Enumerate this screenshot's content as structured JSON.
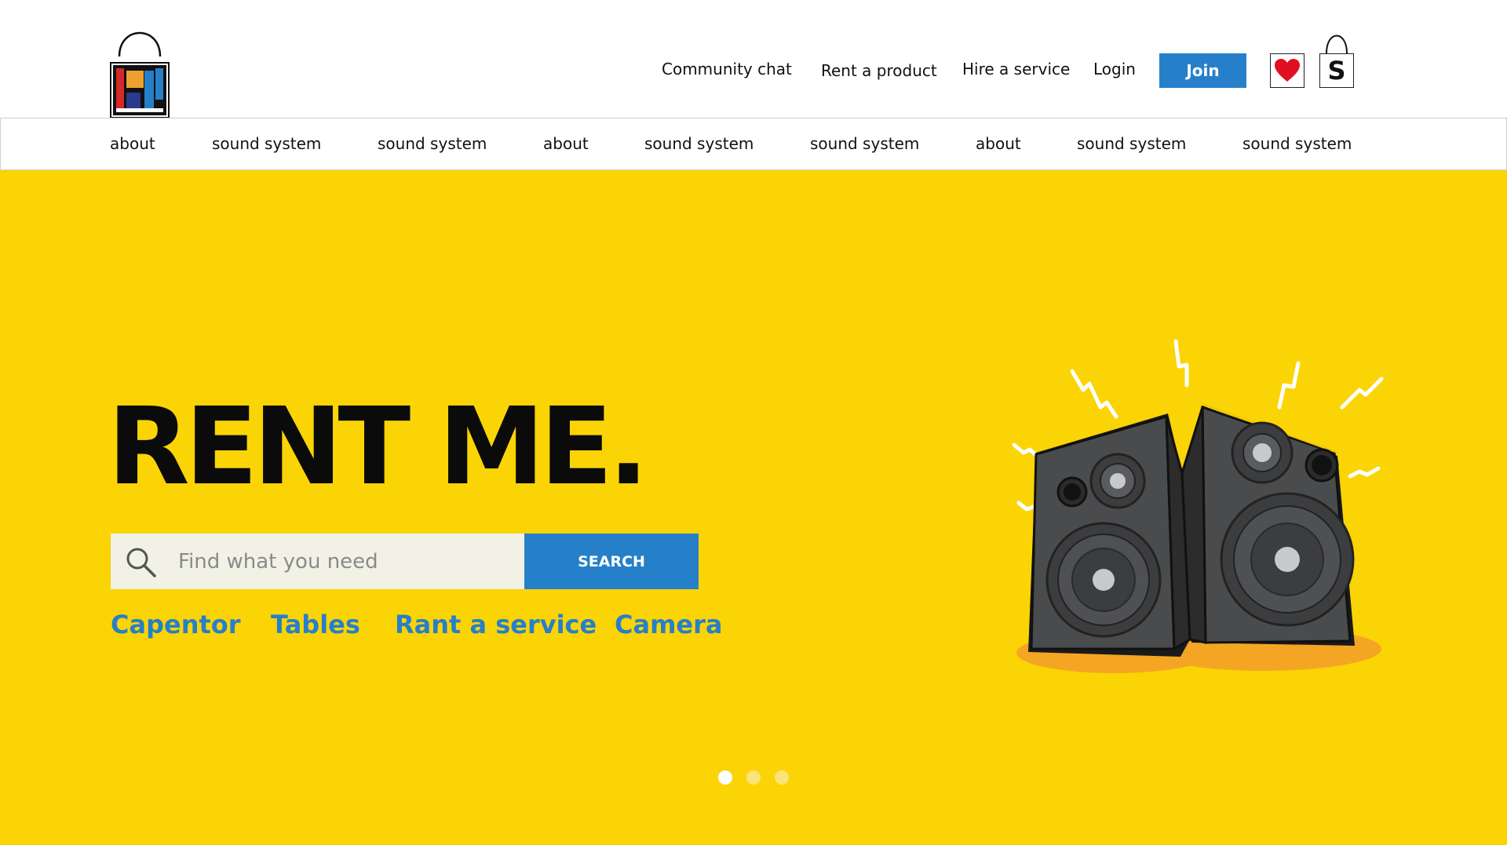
{
  "header": {
    "logo_name": "bag-logo",
    "nav": [
      {
        "label": "Community chat"
      },
      {
        "label": "Rent a product"
      },
      {
        "label": "Hire a service"
      },
      {
        "label": "Login"
      }
    ],
    "join_label": "Join",
    "shop_icon_letter": "S"
  },
  "categories": [
    {
      "label": "about"
    },
    {
      "label": "sound system"
    },
    {
      "label": "sound system"
    },
    {
      "label": "about"
    },
    {
      "label": "sound system"
    },
    {
      "label": "sound system"
    },
    {
      "label": "about"
    },
    {
      "label": "sound system"
    },
    {
      "label": "sound system"
    }
  ],
  "hero": {
    "headline": "RENT ME.",
    "search": {
      "placeholder": "Find what you need",
      "button_label": "SEARCH"
    },
    "quick_links": [
      {
        "label": "Capentor"
      },
      {
        "label": "Tables"
      },
      {
        "label": "Rant a service"
      },
      {
        "label": "Camera"
      }
    ],
    "carousel": {
      "count": 3,
      "active": 1
    },
    "illustration": "speakers-illustration"
  },
  "colors": {
    "hero_bg": "#fad405",
    "accent_blue": "#2680c9",
    "headline": "#0b0b0b",
    "heart_red": "#e01020"
  }
}
